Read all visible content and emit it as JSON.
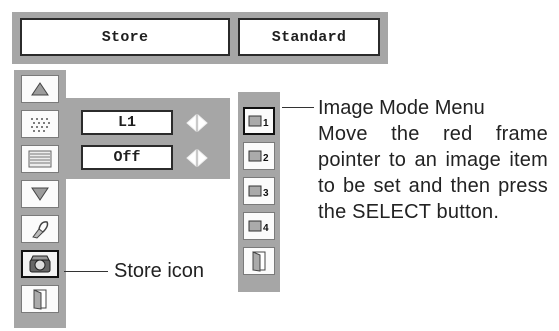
{
  "tabs": {
    "store": "Store",
    "mode": "Standard"
  },
  "side_menu": {
    "items": [
      "up-arrow",
      "noise",
      "stripes",
      "down-arrow",
      "brush",
      "store",
      "door"
    ]
  },
  "settings": {
    "row1_value": "L1",
    "row2_value": "Off"
  },
  "image_mode": {
    "slots": [
      "1",
      "2",
      "3",
      "4"
    ]
  },
  "callouts": {
    "menu_title": "Image Mode Menu",
    "menu_desc": "Move the red frame pointer to an image item to be set and then press the SELECT button.",
    "store_icon": "Store icon"
  },
  "colors": {
    "panel": "#a6a6a6",
    "border": "#2b2b2b",
    "background": "#ffffff"
  }
}
